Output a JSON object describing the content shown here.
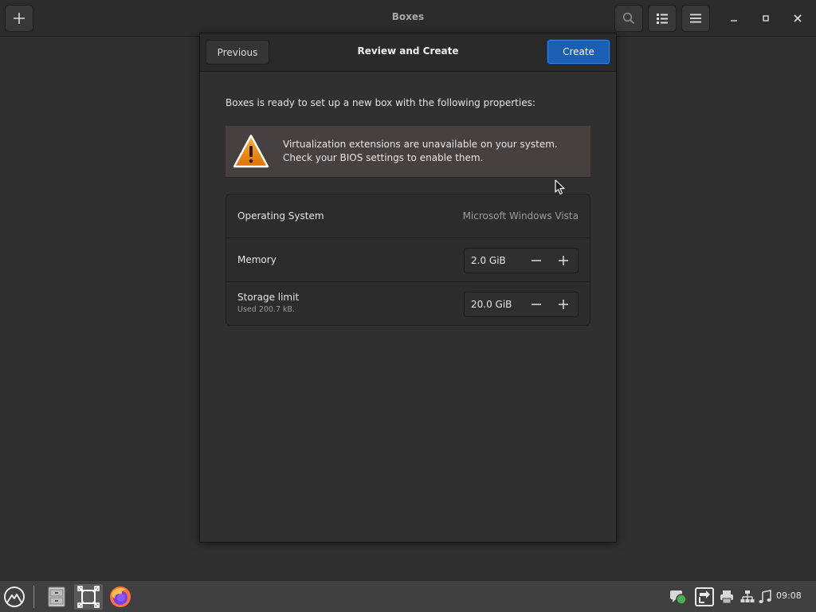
{
  "window": {
    "title": "Boxes"
  },
  "dialog": {
    "title": "Review and Create",
    "previous_label": "Previous",
    "create_label": "Create",
    "intro": "Boxes is ready to set up a new box with the following properties:",
    "warning": {
      "line1": "Virtualization extensions are unavailable on your system.",
      "line2": "Check your BIOS settings to enable them."
    },
    "properties": {
      "os_label": "Operating System",
      "os_value": "Microsoft Windows Vista",
      "memory_label": "Memory",
      "memory_value": "2.0 GiB",
      "storage_label": "Storage limit",
      "storage_sub": "Used 200.7 kB.",
      "storage_value": "20.0 GiB"
    }
  },
  "taskbar": {
    "clock": "09:08",
    "apps": [
      "app-menu-icon",
      "file-manager-icon",
      "boxes-icon",
      "firefox-icon"
    ]
  },
  "colors": {
    "accent": "#1a5fb4",
    "warning": "#f57900"
  }
}
